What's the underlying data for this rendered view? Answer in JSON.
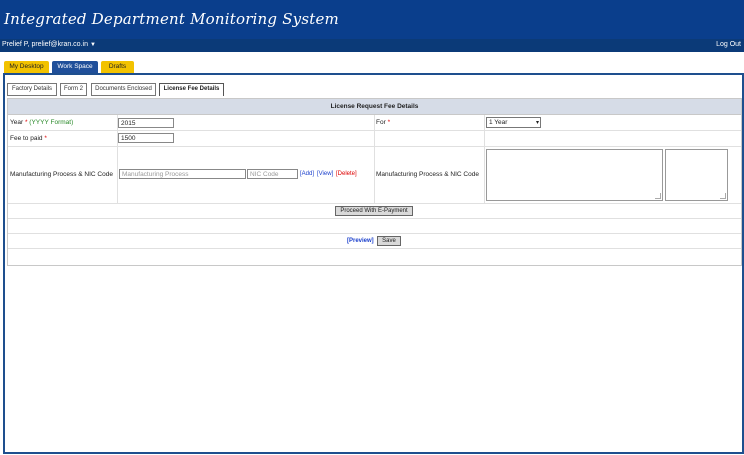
{
  "app": {
    "title": "Integrated Department Monitoring System"
  },
  "user": {
    "label": "Prelief P, prelief@kran.co.in",
    "logout": "Log Out"
  },
  "main_tabs": [
    {
      "label": "My Desktop"
    },
    {
      "label": "Work Space"
    },
    {
      "label": "Drafts"
    }
  ],
  "sub_tabs": [
    {
      "label": "Factory Details"
    },
    {
      "label": "Form 2"
    },
    {
      "label": "Documents Enclosed"
    },
    {
      "label": "License Fee Details"
    }
  ],
  "form": {
    "header": "License Request Fee Details",
    "year_label": "Year",
    "year_req": "*",
    "year_hint": "(YYYY Format)",
    "year_value": "2015",
    "for_label": "For",
    "for_req": "*",
    "for_value": "1 Year",
    "fee_label": "Fee to paid",
    "fee_req": "*",
    "fee_value": "1500",
    "mfg_label": "Manufacturing Process & NIC Code",
    "mfg_placeholder": "Manufacturing Process",
    "nic_placeholder": "NIC Code",
    "add_link": "[Add]",
    "view_link": "[View]",
    "delete_link": "[Delete]",
    "mfg_label_right": "Manufacturing Process & NIC Code",
    "epay_button": "Proceed With E-Payment",
    "preview_link": "[Preview]",
    "save_button": "Save"
  },
  "colors": {
    "header_blue": "#0a3e8c",
    "tab_yellow": "#f2c200",
    "frame_blue": "#1e4f8e"
  }
}
